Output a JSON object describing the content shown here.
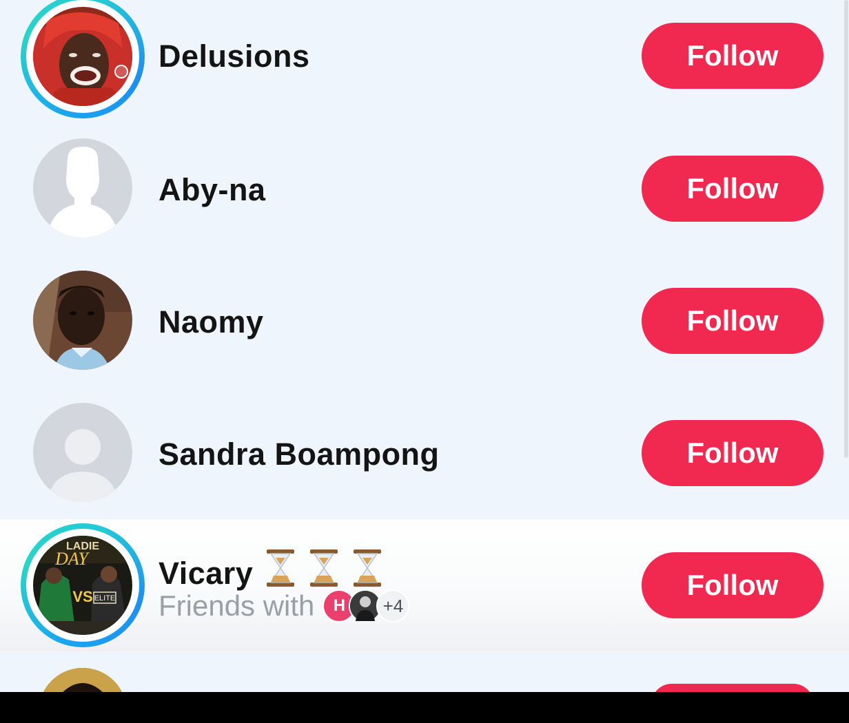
{
  "users": [
    {
      "name": "Delusions",
      "follow_label": "Follow",
      "avatar": "photo-red-headscarf",
      "has_story": true
    },
    {
      "name": "Aby-na",
      "follow_label": "Follow",
      "avatar": "default-silhouette",
      "has_story": false
    },
    {
      "name": "Naomy",
      "follow_label": "Follow",
      "avatar": "photo-selfie",
      "has_story": false
    },
    {
      "name": "Sandra Boampong",
      "follow_label": "Follow",
      "avatar": "default-person",
      "has_story": false
    },
    {
      "name": "Vicary",
      "name_suffix": "⌛⌛⌛",
      "follow_label": "Follow",
      "avatar": "poster-ladies-day",
      "has_story": true,
      "friends_with": {
        "label": "Friends with",
        "first_initial": "H",
        "more_count": "+4"
      }
    }
  ],
  "poster_text": {
    "top": "LADIE",
    "day": "DAY",
    "vs": "VS",
    "elite": "ELITE"
  },
  "colors": {
    "follow": "#f1284f",
    "story_ring": "#1aa6ef",
    "background": "#eef5fc"
  }
}
